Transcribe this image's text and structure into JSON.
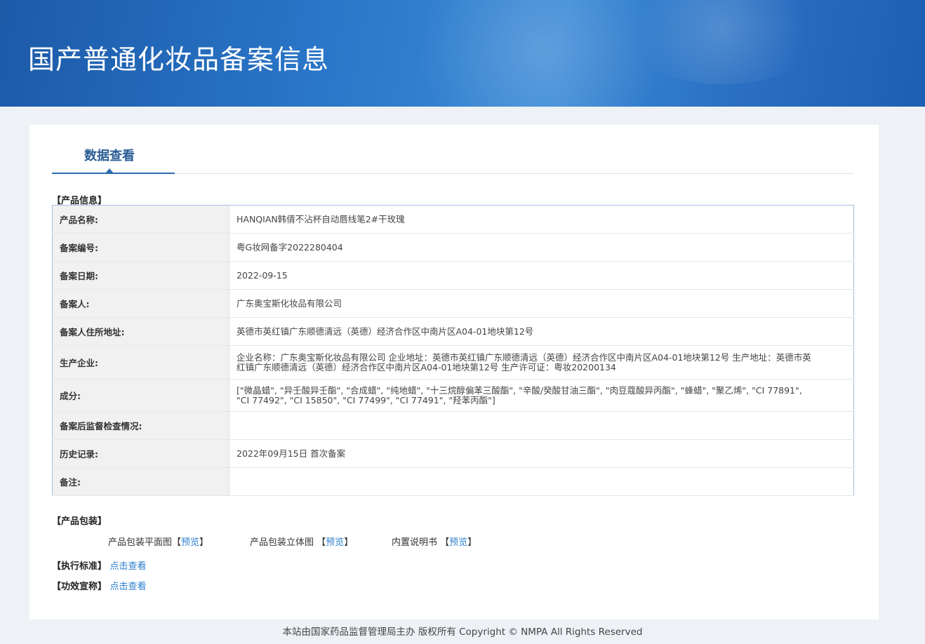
{
  "banner": {
    "title": "国产普通化妆品备案信息"
  },
  "tab": {
    "label": "数据查看"
  },
  "product_info": {
    "section_title": "【产品信息】",
    "rows": [
      {
        "label": "产品名称:",
        "value": "HANQIAN韩倩不沾杯自动唇线笔2#干玫瑰"
      },
      {
        "label": "备案编号:",
        "value": "粤G妆网备字2022280404"
      },
      {
        "label": "备案日期:",
        "value": "2022-09-15"
      },
      {
        "label": "备案人:",
        "value": "广东奥宝斯化妆品有限公司"
      },
      {
        "label": "备案人住所地址:",
        "value": "英德市英红镇广东顺德清远（英德）经济合作区中南片区A04-01地块第12号"
      },
      {
        "label": "生产企业:",
        "value": "企业名称：广东奥宝斯化妆品有限公司 企业地址：英德市英红镇广东顺德清远（英德）经济合作区中南片区A04-01地块第12号 生产地址：英德市英红镇广东顺德清远（英德）经济合作区中南片区A04-01地块第12号 生产许可证：粤妆20200134"
      },
      {
        "label": "成分:",
        "value": "[\"微晶蜡\", \"异壬酸异壬酯\", \"合成蜡\", \"纯地蜡\", \"十三烷醇偏苯三酸酯\", \"辛酸/癸酸甘油三酯\", \"肉豆蔻酸异丙酯\", \"蜂蜡\", \"聚乙烯\", \"CI 77891\", \"CI 77492\", \"CI 15850\", \"CI 77499\", \"CI 77491\", \"羟苯丙酯\"]"
      },
      {
        "label": "备案后监督检查情况:",
        "value": ""
      },
      {
        "label": "历史记录:",
        "value": "2022年09月15日 首次备案"
      },
      {
        "label": "备注:",
        "value": ""
      }
    ]
  },
  "packaging": {
    "section_title": "【产品包装】",
    "items": [
      {
        "label": "产品包装平面图",
        "open": "【",
        "link": "预览",
        "close": "】"
      },
      {
        "label": "产品包装立体图",
        "open": "【",
        "link": "预览",
        "close": "】"
      },
      {
        "label": "内置说明书",
        "open": "【",
        "link": "预览",
        "close": "】"
      }
    ]
  },
  "standard": {
    "label": "【执行标准】",
    "link": "点击查看"
  },
  "efficacy": {
    "label": "【功效宣称】",
    "link": "点击查看"
  },
  "footer": {
    "text": "本站由国家药品监督管理局主办 版权所有 Copyright © NMPA All Rights Reserved"
  }
}
